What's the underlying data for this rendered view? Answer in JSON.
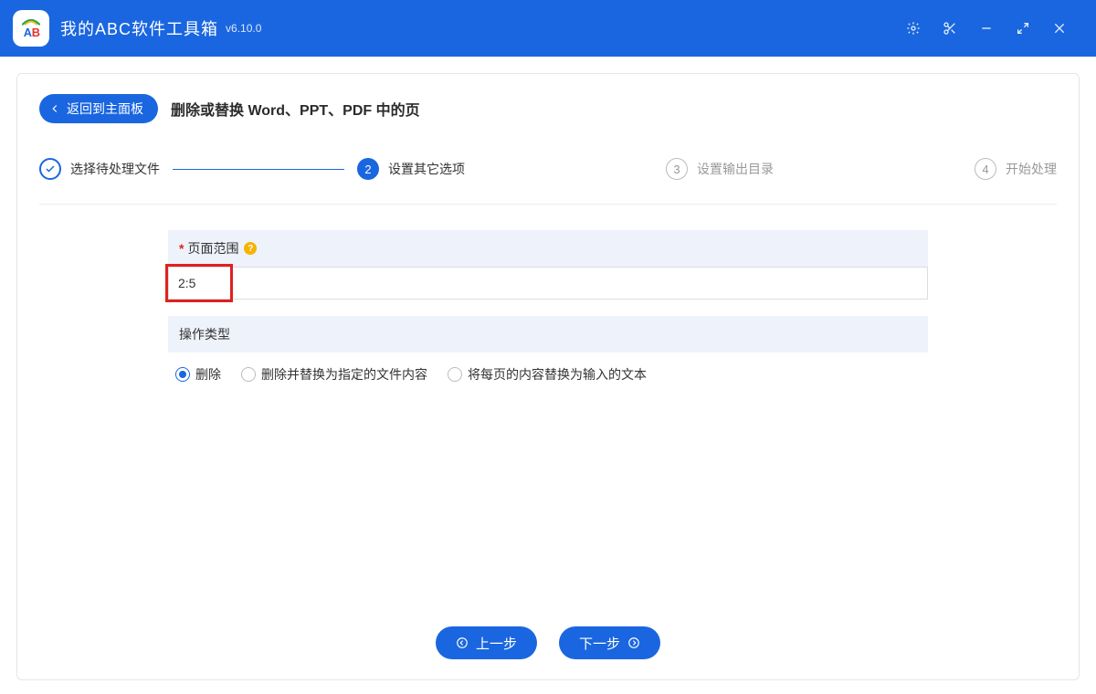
{
  "titlebar": {
    "app_name": "我的ABC软件工具箱",
    "version": "v6.10.0"
  },
  "header": {
    "back_label": "返回到主面板",
    "page_title": "删除或替换 Word、PPT、PDF 中的页"
  },
  "steps": [
    {
      "label": "选择待处理文件",
      "state": "done"
    },
    {
      "label": "设置其它选项",
      "state": "active",
      "number": "2"
    },
    {
      "label": "设置输出目录",
      "state": "pending",
      "number": "3"
    },
    {
      "label": "开始处理",
      "state": "pending",
      "number": "4"
    }
  ],
  "form": {
    "page_range": {
      "label": "页面范围",
      "required_mark": "*",
      "value": "2:5"
    },
    "operation_type": {
      "label": "操作类型",
      "options": [
        {
          "label": "删除",
          "checked": true
        },
        {
          "label": "删除并替换为指定的文件内容",
          "checked": false
        },
        {
          "label": "将每页的内容替换为输入的文本",
          "checked": false
        }
      ]
    }
  },
  "footer": {
    "prev_label": "上一步",
    "next_label": "下一步"
  }
}
